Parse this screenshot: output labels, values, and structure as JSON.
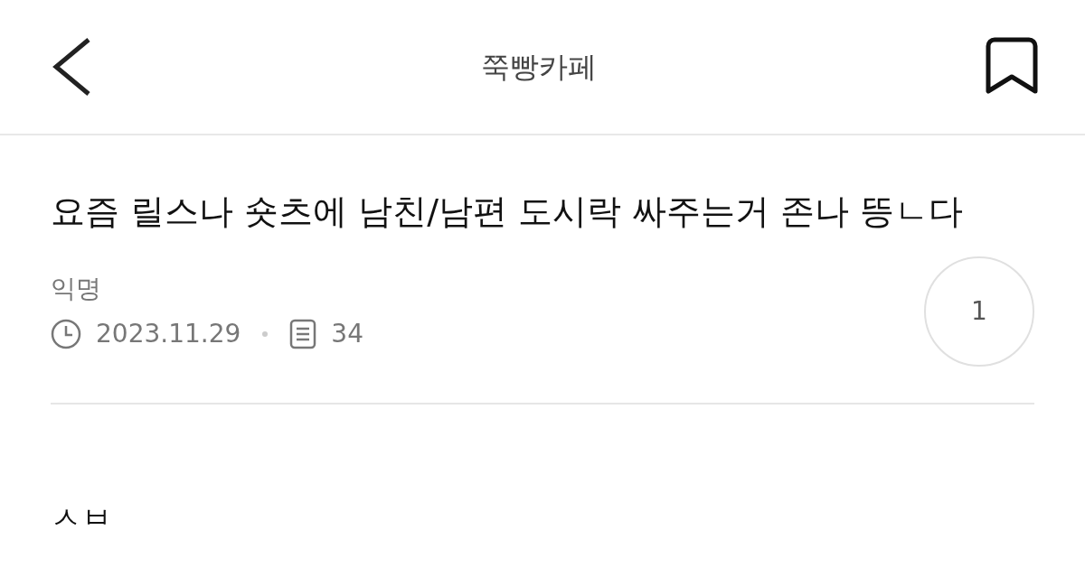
{
  "header": {
    "title": "쭉빵카페",
    "bookmarked": false
  },
  "post": {
    "title": "요즘 릴스나 숏츠에 남친/남편 도시락 싸주는거 존나 뜽ㄴ다",
    "author": "익명",
    "date": "2023.11.29",
    "views": "34",
    "likes": "1",
    "body": "ㅅㅂ"
  }
}
